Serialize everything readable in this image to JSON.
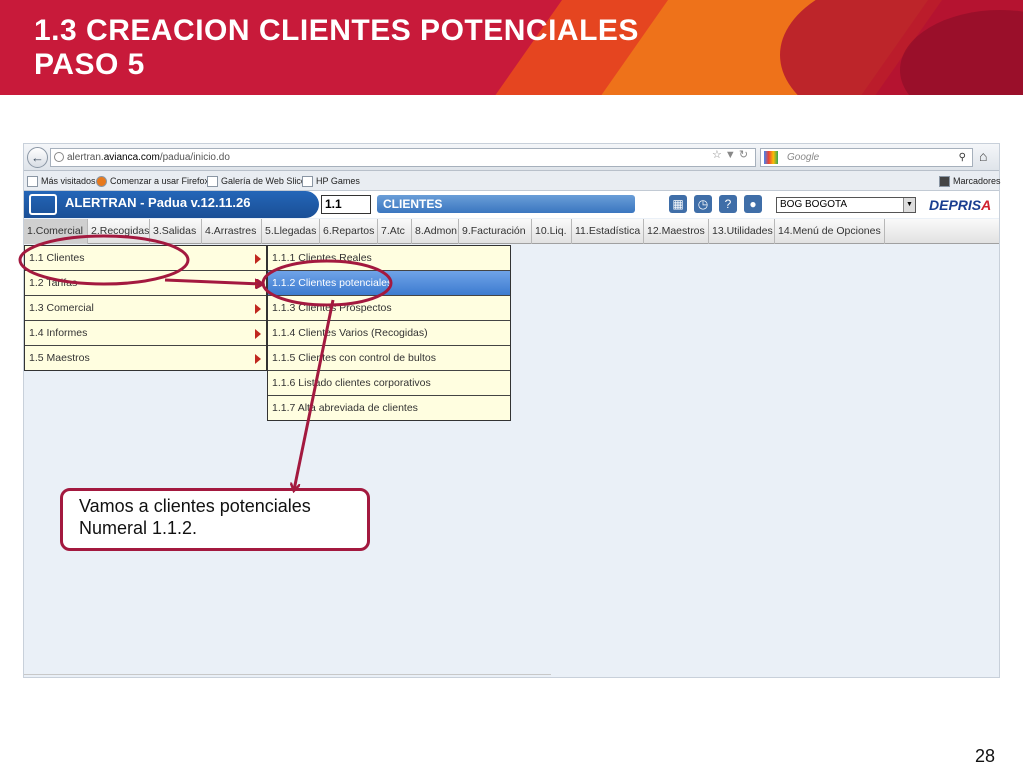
{
  "slide": {
    "title_line1": "1.3 CREACION CLIENTES POTENCIALES",
    "title_line2": "PASO 5",
    "page_number": "28",
    "callout_line1": "Vamos a clientes potenciales",
    "callout_line2": "Numeral 1.1.2."
  },
  "browser": {
    "url_prefix": "alertran.",
    "url_domain": "avianca.com",
    "url_path": "/padua/inicio.do",
    "search_placeholder": "Google",
    "bookmarks": [
      "Más visitados",
      "Comenzar a usar Firefox",
      "Galería de Web Slice",
      "HP Games"
    ],
    "bookmarks_right": "Marcadores"
  },
  "app": {
    "title": "ALERTRAN - Padua  v.12.11.26",
    "code_value": "1.1",
    "module": "CLIENTES",
    "city": "BOG BOGOTA",
    "logo_main": "DEPRIS",
    "logo_accent": "A"
  },
  "menu": {
    "items": [
      "1.Comercial",
      "2.Recogidas",
      "3.Salidas",
      "4.Arrastres",
      "5.Llegadas",
      "6.Repartos",
      "7.Atc",
      "8.Admon",
      "9.Facturación",
      "10.Liq.",
      "11.Estadística",
      "12.Maestros",
      "13.Utilidades",
      "14.Menú de Opciones"
    ],
    "active_index": 0
  },
  "submenu1": {
    "items": [
      "1.1 Clientes",
      "1.2 Tarifas",
      "1.3 Comercial",
      "1.4 Informes",
      "1.5 Maestros"
    ]
  },
  "submenu2": {
    "items": [
      "1.1.1 Clientes Reales",
      "1.1.2 Clientes potenciales",
      "1.1.3 Clientes Prospectos",
      "1.1.4 Clientes Varios (Recogidas)",
      "1.1.5 Clientes con control de bultos",
      "1.1.6 Listado clientes corporativos",
      "1.1.7 Alta abreviada de clientes"
    ],
    "selected_index": 1
  },
  "colors": {
    "banner": "#c81a3a",
    "annotation": "#a3193f",
    "submenu_bg": "#fffee0",
    "selected_bg": "#3d7bd0"
  }
}
